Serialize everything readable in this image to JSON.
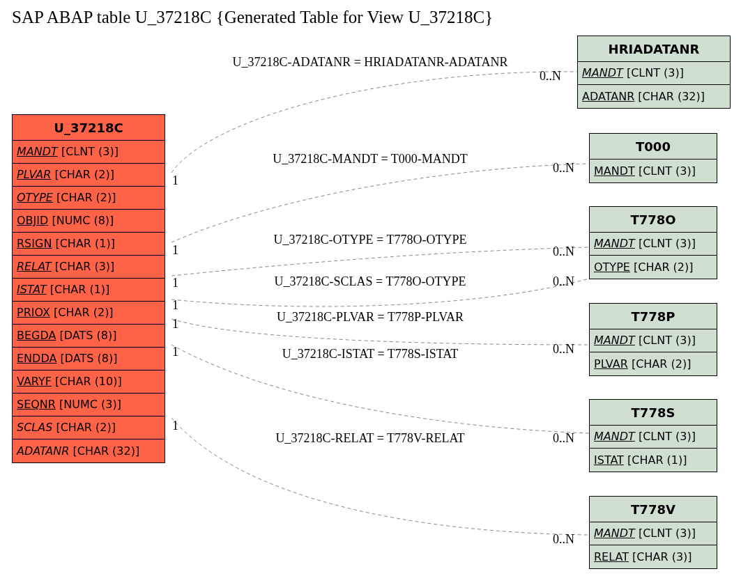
{
  "title": "SAP ABAP table U_37218C {Generated Table for View U_37218C}",
  "entities": [
    {
      "name": "U_37218C",
      "color": "#ff6347",
      "fields": [
        {
          "name": "MANDT",
          "type": "[CLNT (3)]",
          "key": true,
          "italic": true
        },
        {
          "name": "PLVAR",
          "type": "[CHAR (2)]",
          "key": true,
          "italic": true
        },
        {
          "name": "OTYPE",
          "type": "[CHAR (2)]",
          "key": true,
          "italic": true
        },
        {
          "name": "OBJID",
          "type": "[NUMC (8)]",
          "key": true,
          "italic": false
        },
        {
          "name": "RSIGN",
          "type": "[CHAR (1)]",
          "key": true,
          "italic": false
        },
        {
          "name": "RELAT",
          "type": "[CHAR (3)]",
          "key": true,
          "italic": true
        },
        {
          "name": "ISTAT",
          "type": "[CHAR (1)]",
          "key": true,
          "italic": true
        },
        {
          "name": "PRIOX",
          "type": "[CHAR (2)]",
          "key": true,
          "italic": false
        },
        {
          "name": "BEGDA",
          "type": "[DATS (8)]",
          "key": true,
          "italic": false
        },
        {
          "name": "ENDDA",
          "type": "[DATS (8)]",
          "key": true,
          "italic": false
        },
        {
          "name": "VARYF",
          "type": "[CHAR (10)]",
          "key": true,
          "italic": false
        },
        {
          "name": "SEQNR",
          "type": "[NUMC (3)]",
          "key": true,
          "italic": false
        },
        {
          "name": "SCLAS",
          "type": "[CHAR (2)]",
          "key": false,
          "italic": true
        },
        {
          "name": "ADATANR",
          "type": "[CHAR (32)]",
          "key": false,
          "italic": true
        }
      ]
    },
    {
      "name": "HRIADATANR",
      "color": "#d0e0d0",
      "fields": [
        {
          "name": "MANDT",
          "type": "[CLNT (3)]",
          "key": true,
          "italic": true
        },
        {
          "name": "ADATANR",
          "type": "[CHAR (32)]",
          "key": true,
          "italic": false
        }
      ]
    },
    {
      "name": "T000",
      "color": "#d0e0d0",
      "fields": [
        {
          "name": "MANDT",
          "type": "[CLNT (3)]",
          "key": true,
          "italic": false
        }
      ]
    },
    {
      "name": "T778O",
      "color": "#d0e0d0",
      "fields": [
        {
          "name": "MANDT",
          "type": "[CLNT (3)]",
          "key": true,
          "italic": true
        },
        {
          "name": "OTYPE",
          "type": "[CHAR (2)]",
          "key": true,
          "italic": false
        }
      ]
    },
    {
      "name": "T778P",
      "color": "#d0e0d0",
      "fields": [
        {
          "name": "MANDT",
          "type": "[CLNT (3)]",
          "key": true,
          "italic": true
        },
        {
          "name": "PLVAR",
          "type": "[CHAR (2)]",
          "key": true,
          "italic": false
        }
      ]
    },
    {
      "name": "T778S",
      "color": "#d0e0d0",
      "fields": [
        {
          "name": "MANDT",
          "type": "[CLNT (3)]",
          "key": true,
          "italic": true
        },
        {
          "name": "ISTAT",
          "type": "[CHAR (1)]",
          "key": true,
          "italic": false
        }
      ]
    },
    {
      "name": "T778V",
      "color": "#d0e0d0",
      "fields": [
        {
          "name": "MANDT",
          "type": "[CLNT (3)]",
          "key": true,
          "italic": true
        },
        {
          "name": "RELAT",
          "type": "[CHAR (3)]",
          "key": true,
          "italic": false
        }
      ]
    }
  ],
  "relations": [
    {
      "label": "U_37218C-ADATANR = HRIADATANR-ADATANR",
      "from_card": "1",
      "to_card": "0..N"
    },
    {
      "label": "U_37218C-MANDT = T000-MANDT",
      "from_card": "1",
      "to_card": "0..N"
    },
    {
      "label": "U_37218C-OTYPE = T778O-OTYPE",
      "from_card": "1",
      "to_card": "0..N"
    },
    {
      "label": "U_37218C-SCLAS = T778O-OTYPE",
      "from_card": "1",
      "to_card": "0..N"
    },
    {
      "label": "U_37218C-PLVAR = T778P-PLVAR",
      "from_card": "1",
      "to_card": "0..N"
    },
    {
      "label": "U_37218C-ISTAT = T778S-ISTAT",
      "from_card": "1",
      "to_card": "0..N"
    },
    {
      "label": "U_37218C-RELAT = T778V-RELAT",
      "from_card": "1",
      "to_card": "0..N"
    }
  ]
}
